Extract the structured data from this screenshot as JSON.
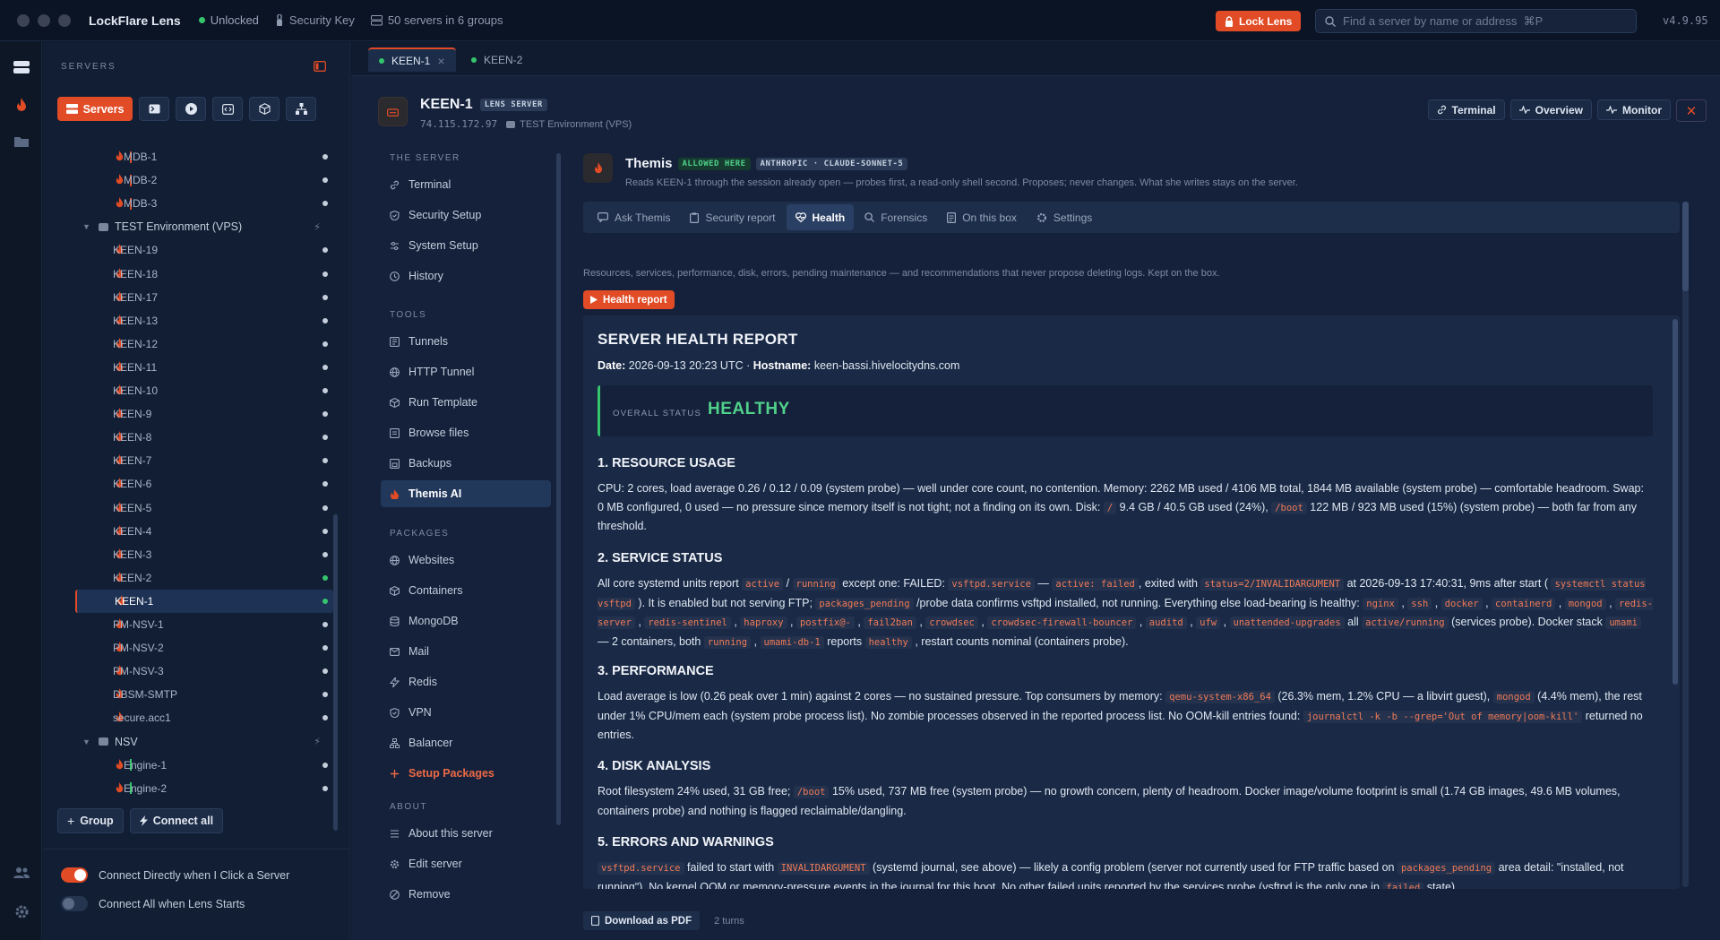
{
  "app": {
    "title": "LockFlare Lens",
    "lock_state": "Unlocked",
    "security_key": "Security Key",
    "servers_summary": "50 servers in 6 groups",
    "lock_button": "Lock Lens",
    "search_placeholder": "Find a server by name or address  ⌘P",
    "version": "v4.9.95"
  },
  "colors": {
    "accent": "#e14b26",
    "healthy": "#4fd18a",
    "online": "#35c56d",
    "background": "#15213a"
  },
  "sidebar": {
    "heading": "SERVERS",
    "mode_button": "Servers",
    "tree": [
      {
        "label": "MDB-1",
        "kind": "server",
        "tag": "red",
        "online": false
      },
      {
        "label": "MDB-2",
        "kind": "server",
        "tag": "red",
        "online": false
      },
      {
        "label": "MDB-3",
        "kind": "server",
        "tag": "red",
        "online": false
      },
      {
        "label": "TEST Environment (VPS)",
        "kind": "group"
      },
      {
        "label": "KEEN-19",
        "kind": "server",
        "online": false
      },
      {
        "label": "KEEN-18",
        "kind": "server",
        "online": false
      },
      {
        "label": "KEEN-17",
        "kind": "server",
        "online": false
      },
      {
        "label": "KEEN-13",
        "kind": "server",
        "online": false
      },
      {
        "label": "KEEN-12",
        "kind": "server",
        "online": false
      },
      {
        "label": "KEEN-11",
        "kind": "server",
        "online": false
      },
      {
        "label": "KEEN-10",
        "kind": "server",
        "online": false
      },
      {
        "label": "KEEN-9",
        "kind": "server",
        "online": false
      },
      {
        "label": "KEEN-8",
        "kind": "server",
        "online": false
      },
      {
        "label": "KEEN-7",
        "kind": "server",
        "online": false
      },
      {
        "label": "KEEN-6",
        "kind": "server",
        "online": false
      },
      {
        "label": "KEEN-5",
        "kind": "server",
        "online": false
      },
      {
        "label": "KEEN-4",
        "kind": "server",
        "online": false
      },
      {
        "label": "KEEN-3",
        "kind": "server",
        "online": false
      },
      {
        "label": "KEEN-2",
        "kind": "server",
        "online": true
      },
      {
        "label": "KEEN-1",
        "kind": "server",
        "online": true,
        "selected": true
      },
      {
        "label": "PM-NSV-1",
        "kind": "server",
        "online": false
      },
      {
        "label": "PM-NSV-2",
        "kind": "server",
        "online": false
      },
      {
        "label": "PM-NSV-3",
        "kind": "server",
        "online": false
      },
      {
        "label": "DBSM-SMTP",
        "kind": "server",
        "online": false
      },
      {
        "label": "secure.acc1",
        "kind": "server",
        "online": false
      },
      {
        "label": "NSV",
        "kind": "group"
      },
      {
        "label": "Engine-1",
        "kind": "server",
        "tag": "green",
        "online": false
      },
      {
        "label": "Engine-2",
        "kind": "server",
        "tag": "green",
        "online": false
      }
    ],
    "group_button": "Group",
    "connect_all_button": "Connect all",
    "toggle_connect_click": "Connect Directly when I Click a Server",
    "toggle_connect_start": "Connect All when Lens Starts"
  },
  "tabs": [
    {
      "label": "KEEN-1",
      "active": true
    },
    {
      "label": "KEEN-2",
      "active": false
    }
  ],
  "server": {
    "name": "KEEN-1",
    "badge": "LENS SERVER",
    "ip": "74.115.172.97",
    "group": "TEST Environment (VPS)",
    "actions": {
      "terminal": "Terminal",
      "overview": "Overview",
      "monitor": "Monitor"
    }
  },
  "subnav": {
    "sections": {
      "server": "THE SERVER",
      "tools": "TOOLS",
      "packages": "PACKAGES",
      "about": "ABOUT"
    },
    "server_items": [
      "Terminal",
      "Security Setup",
      "System Setup",
      "History"
    ],
    "tool_items": [
      "Tunnels",
      "HTTP Tunnel",
      "Run Template",
      "Browse files",
      "Backups",
      "Themis AI"
    ],
    "package_items": [
      "Websites",
      "Containers",
      "MongoDB",
      "Mail",
      "Redis",
      "VPN",
      "Balancer",
      "Setup Packages"
    ],
    "about_items": [
      "About this server",
      "Edit server",
      "Remove"
    ]
  },
  "themis": {
    "name": "Themis",
    "badge_allowed": "ALLOWED HERE",
    "badge_model": "ANTHROPIC · CLAUDE-SONNET-5",
    "description": "Reads KEEN-1 through the session already open — probes first, a read-only shell second. Proposes; never changes. What she writes stays on the server.",
    "tabs": [
      "Ask Themis",
      "Security report",
      "Health",
      "Forensics",
      "On this box",
      "Settings"
    ],
    "intro": "Resources, services, performance, disk, errors, pending maintenance — and recommendations that never propose deleting logs. Kept on the box.",
    "report_button": "Health report",
    "download": "Download as PDF",
    "turns": "2 turns"
  },
  "report": {
    "title": "SERVER HEALTH REPORT",
    "date_label": "Date:",
    "date_value": "2026-09-13 20:23 UTC ·",
    "host_label": "Hostname:",
    "host_value": "keen-bassi.hivelocitydns.com",
    "status_label": "OVERALL STATUS",
    "status_value": "HEALTHY",
    "s1": "1. RESOURCE USAGE",
    "s2": "2. SERVICE STATUS",
    "s3": "3. PERFORMANCE",
    "s4": "4. DISK ANALYSIS",
    "s5": "5. ERRORS AND WARNINGS",
    "p1": [
      {
        "t": "CPU: 2 cores, load average 0.26 / 0.12 / 0.09 (system probe) — well under core count, no contention. Memory: 2262 MB used / 4106 MB total, 1844 MB available (system probe) — comfortable headroom. Swap: 0 MB configured, 0 used — no pressure since memory itself is not tight; not a finding on its own. Disk: "
      },
      {
        "c": "/"
      },
      {
        "t": " 9.4 GB / 40.5 GB used (24%), "
      },
      {
        "c": "/boot"
      },
      {
        "t": " 122 MB / 923 MB used (15%) (system probe) — both far from any threshold."
      }
    ],
    "p2": [
      {
        "t": "All core systemd units report "
      },
      {
        "c": "active"
      },
      {
        "t": " / "
      },
      {
        "c": "running"
      },
      {
        "t": " except one: FAILED: "
      },
      {
        "c": "vsftpd.service"
      },
      {
        "t": " — "
      },
      {
        "c": "active: failed"
      },
      {
        "t": ", exited with "
      },
      {
        "c": "status=2/INVALIDARGUMENT"
      },
      {
        "t": " at 2026-09-13 17:40:31, 9ms after start ( "
      },
      {
        "c": "systemctl status vsftpd"
      },
      {
        "t": " ). It is enabled but not serving FTP; "
      },
      {
        "c": "packages_pending"
      },
      {
        "t": " /probe data confirms vsftpd installed, not running. Everything else load-bearing is healthy: "
      },
      {
        "c": "nginx"
      },
      {
        "t": " , "
      },
      {
        "c": "ssh"
      },
      {
        "t": " , "
      },
      {
        "c": "docker"
      },
      {
        "t": " , "
      },
      {
        "c": "containerd"
      },
      {
        "t": " , "
      },
      {
        "c": "mongod"
      },
      {
        "t": " , "
      },
      {
        "c": "redis-server"
      },
      {
        "t": " , "
      },
      {
        "c": "redis-sentinel"
      },
      {
        "t": " , "
      },
      {
        "c": "haproxy"
      },
      {
        "t": " , "
      },
      {
        "c": "postfix@-"
      },
      {
        "t": " , "
      },
      {
        "c": "fail2ban"
      },
      {
        "t": " , "
      },
      {
        "c": "crowdsec"
      },
      {
        "t": " , "
      },
      {
        "c": "crowdsec-firewall-bouncer"
      },
      {
        "t": " , "
      },
      {
        "c": "auditd"
      },
      {
        "t": " , "
      },
      {
        "c": "ufw"
      },
      {
        "t": " , "
      },
      {
        "c": "unattended-upgrades"
      },
      {
        "t": " all "
      },
      {
        "c": "active/running"
      },
      {
        "t": " (services probe). Docker stack "
      },
      {
        "c": "umami"
      },
      {
        "t": " — 2 containers, both "
      },
      {
        "c": "running"
      },
      {
        "t": " , "
      },
      {
        "c": "umami-db-1"
      },
      {
        "t": " reports "
      },
      {
        "c": "healthy"
      },
      {
        "t": " , restart counts nominal (containers probe)."
      }
    ],
    "p3": [
      {
        "t": "Load average is low (0.26 peak over 1 min) against 2 cores — no sustained pressure. Top consumers by memory: "
      },
      {
        "c": "qemu-system-x86_64"
      },
      {
        "t": " (26.3% mem, 1.2% CPU — a libvirt guest), "
      },
      {
        "c": "mongod"
      },
      {
        "t": " (4.4% mem), the rest under 1% CPU/mem each (system probe process list). No zombie processes observed in the reported process list. No OOM-kill entries found: "
      },
      {
        "c": "journalctl -k -b --grep='Out of memory|oom-kill'"
      },
      {
        "t": " returned no entries."
      }
    ],
    "p4": [
      {
        "t": "Root filesystem 24% used, 31 GB free; "
      },
      {
        "c": "/boot"
      },
      {
        "t": " 15% used, 737 MB free (system probe) — no growth concern, plenty of headroom. Docker image/volume footprint is small (1.74 GB images, 49.6 MB volumes, containers probe) and nothing is flagged reclaimable/dangling."
      }
    ],
    "p5": [
      {
        "c": "vsftpd.service"
      },
      {
        "t": " failed to start with "
      },
      {
        "c": "INVALIDARGUMENT"
      },
      {
        "t": " (systemd journal, see above) — likely a config problem (server not currently used for FTP traffic based on "
      },
      {
        "c": "packages_pending"
      },
      {
        "t": " area detail: \"installed, not running\"). No kernel OOM or memory-pressure events in the journal for this boot. No other failed units reported by the services probe (vsftpd is the only one in "
      },
      {
        "c": "failed"
      },
      {
        "t": " state)."
      }
    ]
  }
}
